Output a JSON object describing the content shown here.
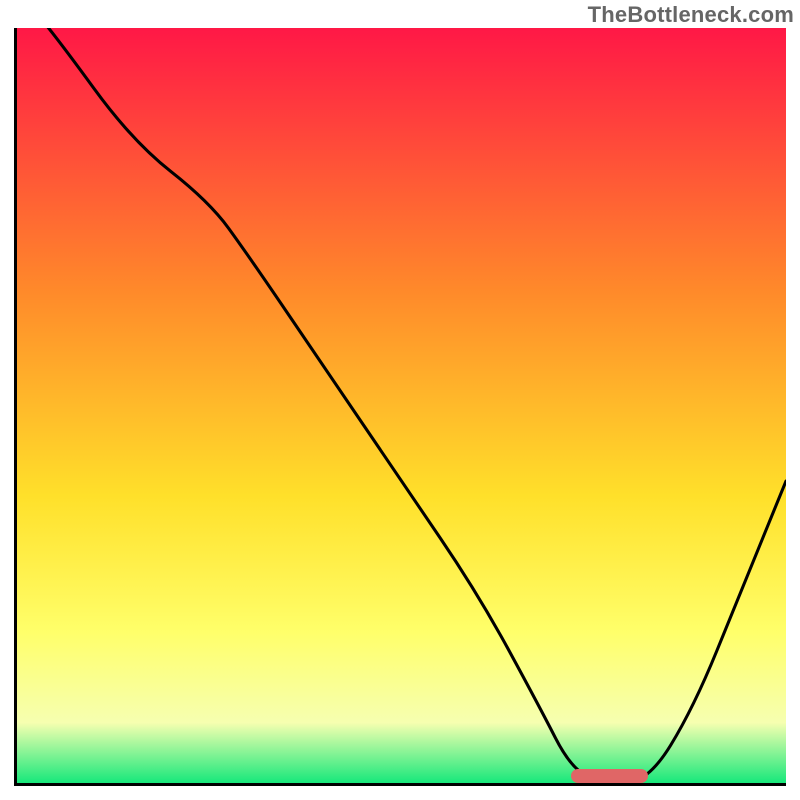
{
  "watermark": "TheBottleneck.com",
  "colors": {
    "gradient_top": "#ff1846",
    "gradient_mid1": "#ff8a2a",
    "gradient_mid2": "#ffe02a",
    "gradient_mid3": "#ffff6a",
    "gradient_mid4": "#f6ffb0",
    "gradient_bottom": "#17e87b",
    "curve": "#000000",
    "marker": "#e06666",
    "axis": "#000000"
  },
  "chart_data": {
    "type": "line",
    "title": "",
    "xlabel": "",
    "ylabel": "",
    "xlim": [
      0,
      100
    ],
    "ylim": [
      0,
      100
    ],
    "x": [
      0,
      5,
      15,
      25,
      30,
      40,
      50,
      60,
      68,
      72,
      76,
      82,
      88,
      94,
      100
    ],
    "values": [
      105,
      99,
      85,
      77,
      70,
      55,
      40,
      25,
      10,
      2,
      0,
      0,
      10,
      25,
      40
    ],
    "marker_range_x": [
      72,
      82
    ],
    "notes": "Single black curve over vertical red→green gradient; minimum region highlighted by a short red bar on the x-axis. No axis ticks or labels are shown."
  }
}
